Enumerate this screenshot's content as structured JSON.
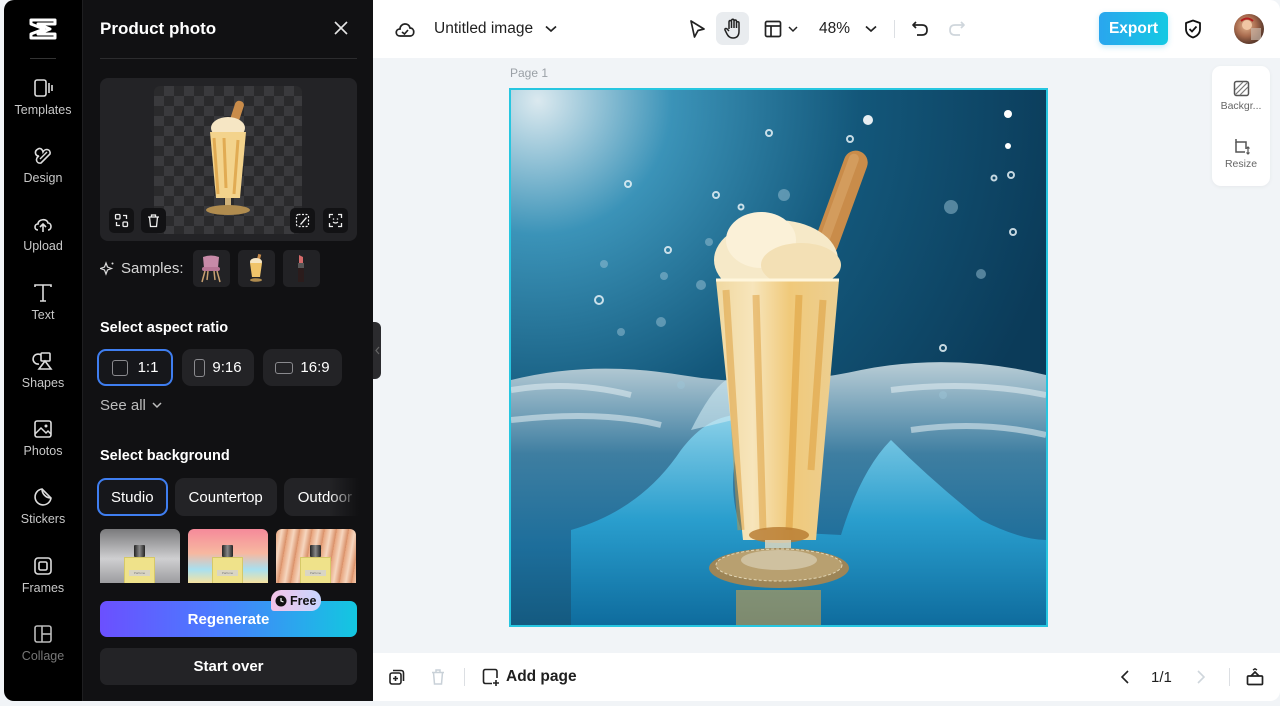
{
  "rail": {
    "items": [
      {
        "id": "templates",
        "label": "Templates",
        "icon": "templates-icon"
      },
      {
        "id": "design",
        "label": "Design",
        "icon": "design-icon"
      },
      {
        "id": "upload",
        "label": "Upload",
        "icon": "upload-icon"
      },
      {
        "id": "text",
        "label": "Text",
        "icon": "text-icon"
      },
      {
        "id": "shapes",
        "label": "Shapes",
        "icon": "shapes-icon"
      },
      {
        "id": "photos",
        "label": "Photos",
        "icon": "photos-icon"
      },
      {
        "id": "stickers",
        "label": "Stickers",
        "icon": "stickers-icon"
      },
      {
        "id": "frames",
        "label": "Frames",
        "icon": "frames-icon"
      },
      {
        "id": "collage",
        "label": "Collage",
        "icon": "collage-icon"
      }
    ]
  },
  "panel": {
    "title": "Product photo",
    "samples_label": "Samples:",
    "samples": [
      "chair",
      "milkshake",
      "lipstick"
    ],
    "aspect_title": "Select aspect ratio",
    "aspect_ratios": [
      {
        "label": "1:1",
        "selected": true
      },
      {
        "label": "9:16",
        "selected": false
      },
      {
        "label": "16:9",
        "selected": false
      }
    ],
    "see_all": "See all",
    "background_title": "Select background",
    "background_tabs": [
      {
        "label": "Studio",
        "selected": true
      },
      {
        "label": "Countertop",
        "selected": false
      },
      {
        "label": "Outdoor",
        "selected": false
      }
    ],
    "background_thumbs": [
      {
        "name": "studio-silver",
        "product_label": "Parfume"
      },
      {
        "name": "pastel-gradient",
        "product_label": "Parfume"
      },
      {
        "name": "peach-curtain",
        "product_label": "Parfume"
      }
    ],
    "regenerate": "Regenerate",
    "free_badge": "Free",
    "start_over": "Start over"
  },
  "topbar": {
    "doc_title": "Untitled image",
    "zoom": "48%",
    "export": "Export"
  },
  "canvas": {
    "page_label": "Page 1"
  },
  "side_tools": [
    {
      "label": "Backgr...",
      "icon": "background-icon"
    },
    {
      "label": "Resize",
      "icon": "resize-icon"
    }
  ],
  "bottombar": {
    "add_page": "Add page",
    "page_count": "1/1"
  },
  "colors": {
    "accent": "#27c6e0",
    "selected_border": "#3f7ef0",
    "export_start": "#2aa6ee",
    "export_end": "#14c9e3",
    "panel_bg": "#111113"
  }
}
